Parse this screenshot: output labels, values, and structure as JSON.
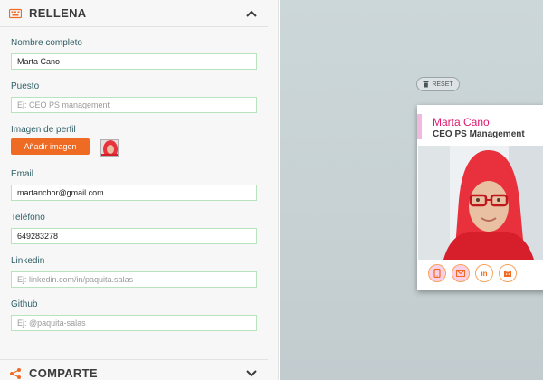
{
  "form": {
    "section_title": "RELLENA",
    "fields": {
      "name": {
        "label": "Nombre completo",
        "value": "Marta Cano"
      },
      "role": {
        "label": "Puesto",
        "placeholder": "Ej: CEO PS management"
      },
      "image": {
        "label": "Imagen de perfil",
        "button": "Añadir imagen"
      },
      "email": {
        "label": "Email",
        "value": "martanchor@gmail.com"
      },
      "phone": {
        "label": "Teléfono",
        "value": "649283278"
      },
      "linkedin": {
        "label": "Linkedin",
        "placeholder": "Ej: linkedin.com/in/paquita.salas"
      },
      "github": {
        "label": "Github",
        "placeholder": "Ej: @paquita-salas"
      }
    },
    "share_title": "COMPARTE"
  },
  "preview": {
    "reset_label": "RESET",
    "card": {
      "name": "Marta Cano",
      "role": "CEO PS Management",
      "icons": [
        "phone-icon",
        "mail-icon",
        "linkedin-icon",
        "github-icon"
      ]
    }
  },
  "colors": {
    "accent_orange": "#ef6a22",
    "name_pink": "#e0196d",
    "field_border": "#b7e4bd"
  }
}
